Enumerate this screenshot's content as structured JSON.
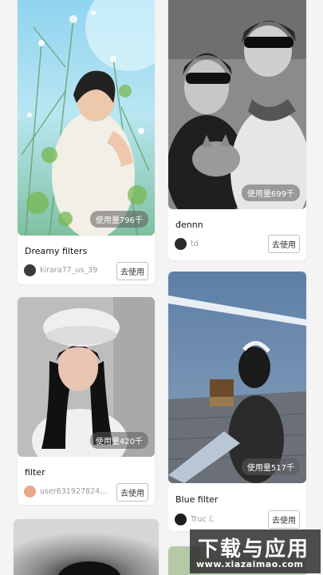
{
  "cards": [
    {
      "title": "Dreamy filters",
      "author": "kirara77_us_39",
      "usage": "使用量796千",
      "button": "去使用"
    },
    {
      "title": "đennn",
      "author": "td",
      "usage": "使用量699千",
      "button": "去使用"
    },
    {
      "title": "filter",
      "author": "user631927824…",
      "usage": "使用量420千",
      "button": "去使用"
    },
    {
      "title": "Blue filter",
      "author": "Truc ℒ",
      "usage": "使用量517千",
      "button": "去使用"
    }
  ],
  "watermark": {
    "main": "下载与应用",
    "url": "www.xiazaimao.com"
  }
}
